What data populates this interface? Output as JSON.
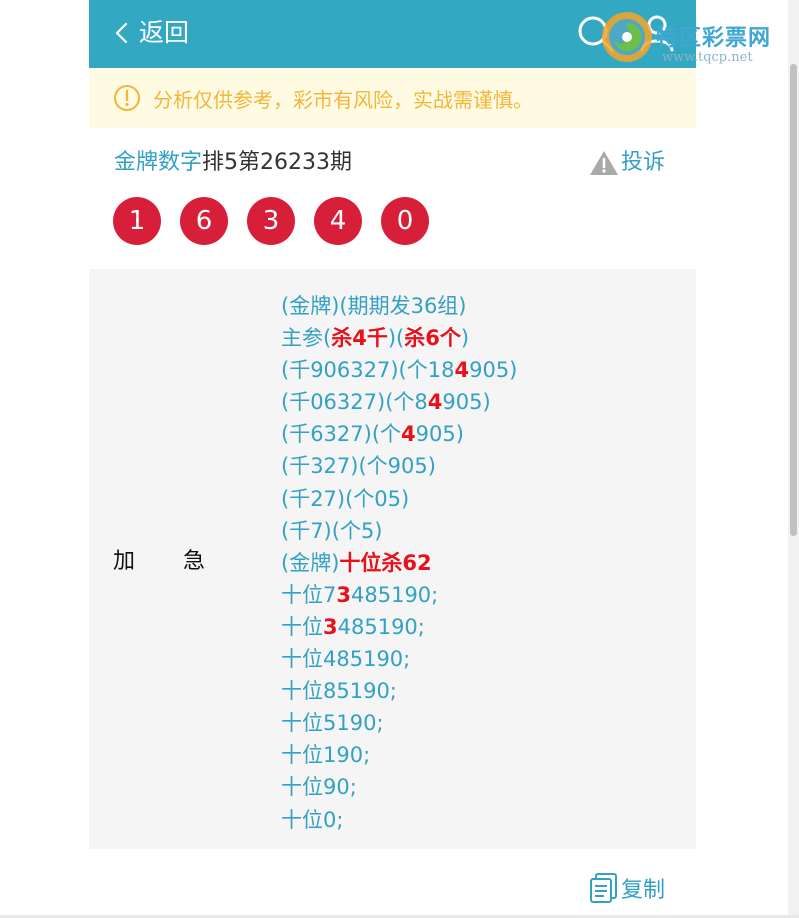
{
  "header": {
    "back_label": "返回",
    "bg_color": "#33a8c2"
  },
  "watermark": {
    "name": "特区彩票网",
    "url": "www.tqcp.net"
  },
  "notice": {
    "text": "分析仅供参考，彩市有风险，实战需谨慎。"
  },
  "title": {
    "brand": "金牌数字",
    "issue": "排5第26233期"
  },
  "report_label": "投诉",
  "balls": [
    "1",
    "6",
    "3",
    "4",
    "0"
  ],
  "panel": {
    "label_left": "加",
    "label_right": "急",
    "lines": [
      [
        {
          "t": "(金牌)(期期发36组)"
        }
      ],
      [
        {
          "t": "主参("
        },
        {
          "t": "杀4千",
          "r": true
        },
        {
          "t": ")("
        },
        {
          "t": "杀6个",
          "r": true
        },
        {
          "t": ")"
        }
      ],
      [
        {
          "t": "(千906327)(个18"
        },
        {
          "t": "4",
          "r": true
        },
        {
          "t": "905)"
        }
      ],
      [
        {
          "t": "(千06327)(个8"
        },
        {
          "t": "4",
          "r": true
        },
        {
          "t": "905)"
        }
      ],
      [
        {
          "t": "(千6327)(个"
        },
        {
          "t": "4",
          "r": true
        },
        {
          "t": "905)"
        }
      ],
      [
        {
          "t": "(千327)(个905)"
        }
      ],
      [
        {
          "t": "(千27)(个05)"
        }
      ],
      [
        {
          "t": "(千7)(个5)"
        }
      ],
      [
        {
          "t": "(金牌)"
        },
        {
          "t": "十位杀62",
          "r": true
        }
      ],
      [
        {
          "t": "十位7"
        },
        {
          "t": "3",
          "r": true
        },
        {
          "t": "485190;"
        }
      ],
      [
        {
          "t": "十位"
        },
        {
          "t": "3",
          "r": true
        },
        {
          "t": "485190;"
        }
      ],
      [
        {
          "t": "十位485190;"
        }
      ],
      [
        {
          "t": "十位85190;"
        }
      ],
      [
        {
          "t": "十位5190;"
        }
      ],
      [
        {
          "t": "十位190;"
        }
      ],
      [
        {
          "t": "十位90;"
        }
      ],
      [
        {
          "t": "十位0;"
        }
      ]
    ]
  },
  "copy_label": "复制",
  "colors": {
    "accent": "#33a0c4",
    "ball": "#d71f3a",
    "highlight": "#e8101a",
    "notice_bg": "#fffbe3",
    "notice_text": "#f3b63c"
  }
}
